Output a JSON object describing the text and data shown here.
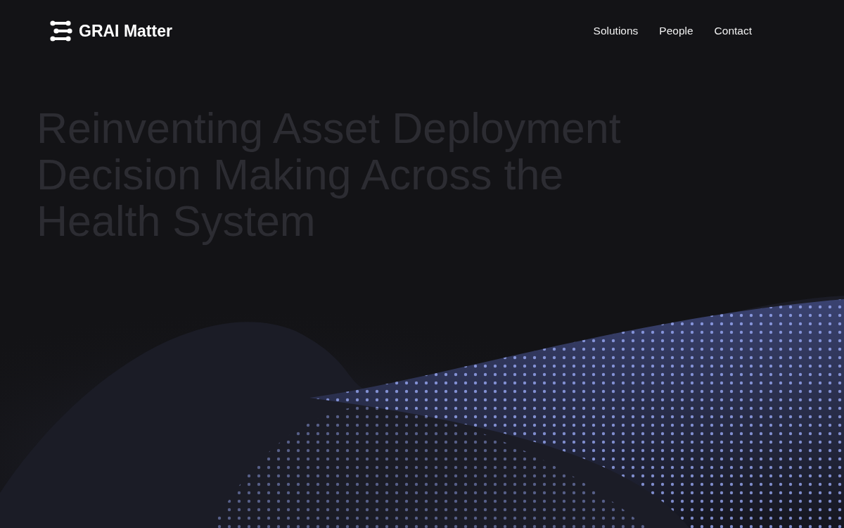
{
  "header": {
    "logo": {
      "text": "GRAI Matter"
    },
    "nav": [
      {
        "label": "Solutions"
      },
      {
        "label": "People"
      },
      {
        "label": "Contact"
      }
    ]
  },
  "hero": {
    "heading": "Reinventing Asset Deployment Decision Making Across the Health System"
  }
}
